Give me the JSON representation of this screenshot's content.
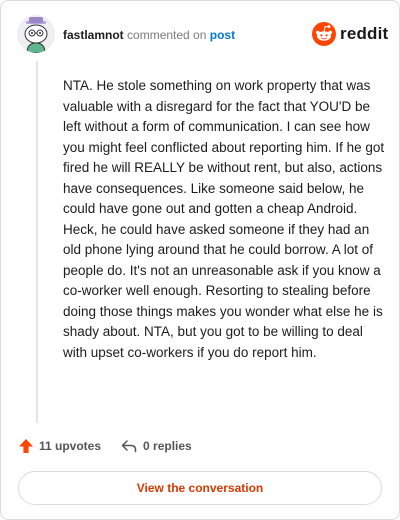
{
  "comment": {
    "author": "fastlamnot",
    "action_text": "commented on",
    "target_link": "post",
    "body": "NTA. He stole something on work property that was valuable with a disregard for the fact that YOU'D be left without a form of communication. I can see how you might feel conflicted about reporting him. If he got fired he will REALLY be without rent, but also, actions have consequences. Like someone said below, he could have gone out and gotten a cheap Android. Heck, he could have asked someone if they had an old phone lying around that he could borrow. A lot of people do. It's not an unreasonable ask if you know a co-worker well enough. Resorting to stealing before doing those things makes you wonder what else he is shady about. NTA, but you got to be willing to deal with upset co-workers if you do report him.",
    "upvotes_label": "11 upvotes",
    "replies_label": "0 replies"
  },
  "brand": {
    "name": "reddit",
    "icon": "reddit-snoo-icon",
    "color": "#ff4500"
  },
  "footer": {
    "view_button_label": "View the conversation"
  },
  "icons": {
    "upvote": "upvote-arrow-icon",
    "reply": "reply-arrow-icon",
    "avatar": "snoo-avatar"
  },
  "colors": {
    "accent_orange": "#ff4500",
    "link_blue": "#0079d3",
    "button_text": "#d93900"
  }
}
